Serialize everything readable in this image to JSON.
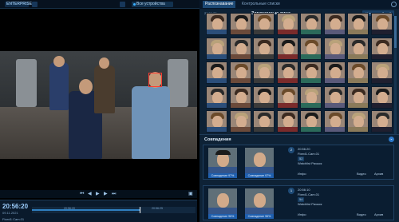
{
  "app": {
    "logo": "ENTERPRISE",
    "device_selector": "Все устройства"
  },
  "tabs": [
    {
      "label": "Распознавание"
    },
    {
      "label": "Контрольные списки"
    }
  ],
  "faces": {
    "time": "20:56:25",
    "title": "Замеченные лица",
    "history_button": "История событий"
  },
  "player": {
    "time": "20:56:20",
    "date": "09.11.2021",
    "camera": "Fixed1.Cam.01",
    "timeline_labels": [
      "20:56:20",
      "20:56:25"
    ],
    "progress": 0.66
  },
  "matches": {
    "title": "Совпадения",
    "items": [
      {
        "num": "2",
        "captured_caption": "Совпадение 97%",
        "list_caption": "Совпадение 97%",
        "time": "20:56:20",
        "camera": "Fixed1.Cam.01",
        "similarity": "52",
        "list": "Watchlist Разыск",
        "info_button": "Инфо",
        "video_button": "Видео",
        "archive_button": "Архив"
      },
      {
        "num": "1",
        "captured_caption": "Совпадение 96%",
        "list_caption": "Совпадение 96%",
        "time": "20:56:10",
        "camera": "Fixed1.Cam.01",
        "similarity": "54",
        "list": "Watchlist Разыск",
        "info_button": "Инфо",
        "video_button": "Видео",
        "archive_button": "Архив"
      }
    ]
  },
  "colors": {
    "accent": "#2c78c8",
    "panel": "#0e2236",
    "face_box": "#ff3b30"
  }
}
